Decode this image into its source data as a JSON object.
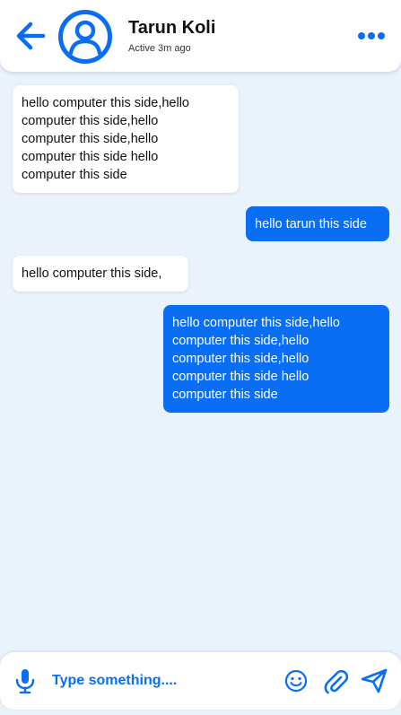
{
  "theme": {
    "accent": "#0a6ef5",
    "background": "#eaf3fc",
    "incoming_bubble": "#ffffff",
    "outgoing_bubble": "#0a6ef5"
  },
  "header": {
    "back_icon": "arrow-left-icon",
    "avatar_icon": "user-circle-icon",
    "name": "Tarun Koli",
    "status": "Active 3m ago",
    "menu_icon": "more-horizontal-icon"
  },
  "messages": [
    {
      "direction": "incoming",
      "text": "hello computer this side,hello\ncomputer this side,hello\ncomputer this side,hello\ncomputer this side hello\ncomputer this side"
    },
    {
      "direction": "outgoing",
      "text": "hello tarun this side"
    },
    {
      "direction": "incoming",
      "text": "hello computer this side,"
    },
    {
      "direction": "outgoing",
      "text": "hello computer this side,hello\ncomputer this side,hello\ncomputer this side,hello\ncomputer this side hello\ncomputer this side"
    }
  ],
  "composer": {
    "mic_icon": "microphone-icon",
    "placeholder": "Type something....",
    "value": "",
    "emoji_icon": "smiley-icon",
    "attach_icon": "paperclip-icon",
    "send_icon": "send-icon"
  }
}
